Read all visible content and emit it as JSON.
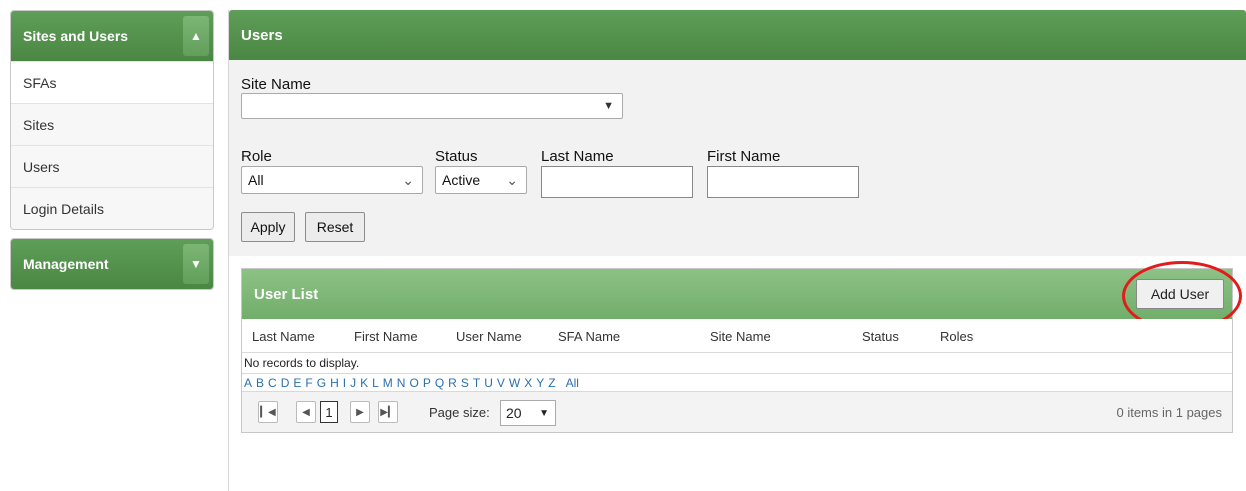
{
  "sidebar": {
    "section1_title": "Sites and Users",
    "section1_toggle": "^",
    "items": [
      {
        "label": "SFAs"
      },
      {
        "label": "Sites"
      },
      {
        "label": "Users"
      },
      {
        "label": "Login Details"
      }
    ],
    "section2_title": "Management",
    "section2_toggle": "⌄"
  },
  "main": {
    "title": "Users",
    "filters": {
      "site_name_label": "Site Name",
      "site_name_value": "",
      "role_label": "Role",
      "role_value": "All",
      "status_label": "Status",
      "status_value": "Active",
      "last_name_label": "Last Name",
      "last_name_value": "",
      "first_name_label": "First Name",
      "first_name_value": "",
      "apply_label": "Apply",
      "reset_label": "Reset"
    },
    "user_list": {
      "title": "User List",
      "add_user_label": "Add User",
      "columns": [
        "Last Name",
        "First Name",
        "User Name",
        "SFA Name",
        "Site Name",
        "Status",
        "Roles"
      ],
      "empty_message": "No records to display.",
      "letters": [
        "A",
        "B",
        "C",
        "D",
        "E",
        "F",
        "G",
        "H",
        "I",
        "J",
        "K",
        "L",
        "M",
        "N",
        "O",
        "P",
        "Q",
        "R",
        "S",
        "T",
        "U",
        "V",
        "W",
        "X",
        "Y",
        "Z",
        "All"
      ],
      "pager": {
        "current_page": "1",
        "page_size_label": "Page size:",
        "page_size_value": "20",
        "info": "0 items in 1 pages"
      }
    }
  },
  "colors": {
    "header_green": "#4a8744",
    "list_header_green": "#72ae6b",
    "highlight_red": "#e21b1b",
    "link_blue": "#2a6fb0"
  }
}
